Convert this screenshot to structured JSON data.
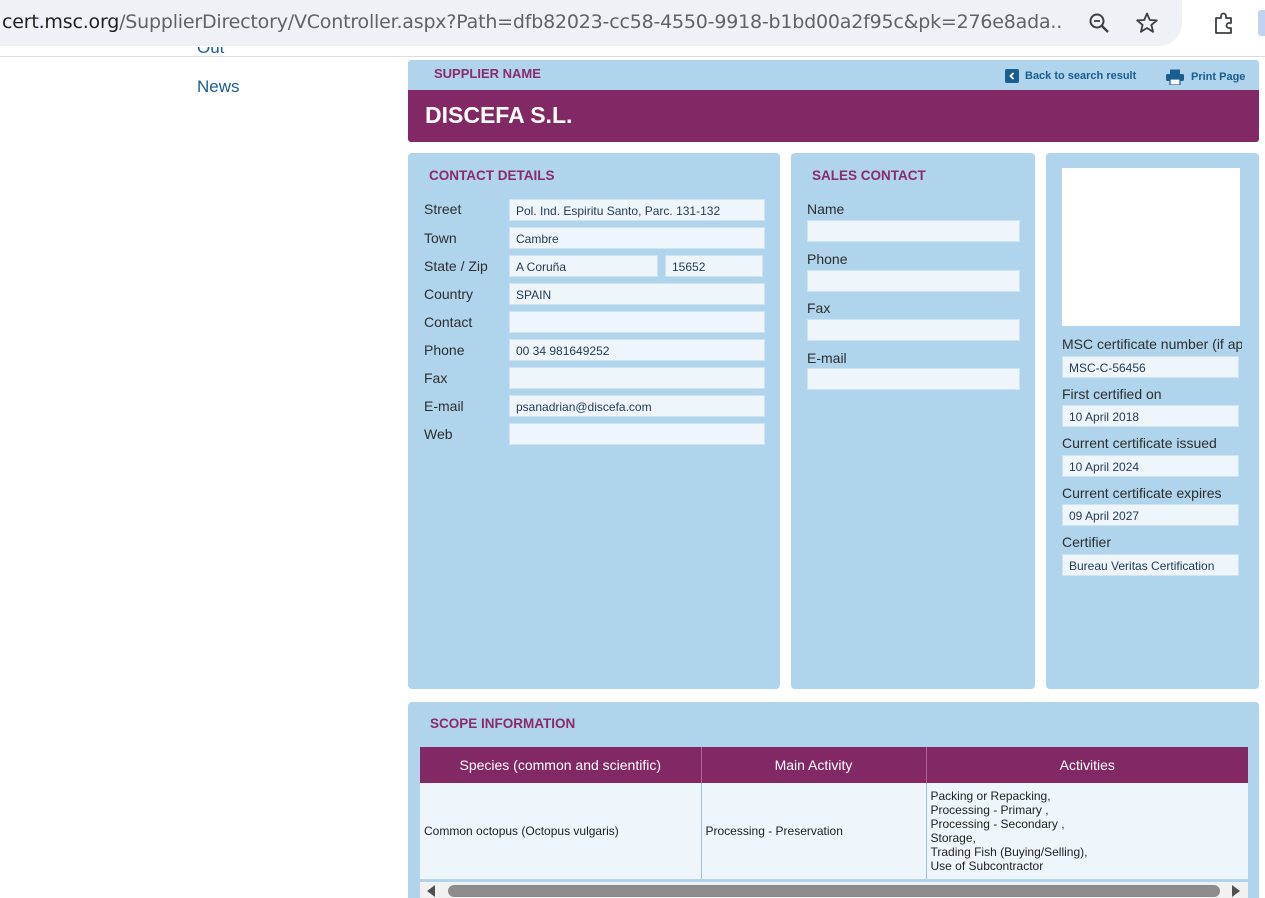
{
  "browser": {
    "url_host": "cert.msc.org",
    "url_path": "/SupplierDirectory/VController.aspx?Path=dfb82023-cc58-4550-9918-b1bd00a2f95c&pk=276e8ada..."
  },
  "nav": {
    "cut_item": "Out",
    "news": "News"
  },
  "supplier": {
    "label": "SUPPLIER NAME",
    "name": "DISCEFA S.L.",
    "back_link": "Back to search result",
    "print_link": "Print Page"
  },
  "contact": {
    "title": "CONTACT DETAILS",
    "street_label": "Street",
    "street": "Pol. Ind. Espiritu Santo, Parc. 131-132",
    "town_label": "Town",
    "town": "Cambre",
    "state_zip_label": "State / Zip",
    "state": "A Coruña",
    "zip": "15652",
    "country_label": "Country",
    "country": "SPAIN",
    "contact_label": "Contact",
    "contact": "",
    "phone_label": "Phone",
    "phone": "00 34 981649252",
    "fax_label": "Fax",
    "fax": "",
    "email_label": "E-mail",
    "email": "psanadrian@discefa.com",
    "web_label": "Web",
    "web": ""
  },
  "sales": {
    "title": "SALES CONTACT",
    "name_label": "Name",
    "name": "",
    "phone_label": "Phone",
    "phone": "",
    "fax_label": "Fax",
    "fax": "",
    "email_label": "E-mail",
    "email": ""
  },
  "certificate": {
    "number_label": "MSC certificate number (if applicable)",
    "number": "MSC-C-56456",
    "first_label": "First certified on",
    "first": "10 April 2018",
    "issued_label": "Current certificate issued",
    "issued": "10 April 2024",
    "expires_label": "Current certificate expires",
    "expires": "09 April 2027",
    "certifier_label": "Certifier",
    "certifier": "Bureau Veritas Certification"
  },
  "scope": {
    "title": "SCOPE INFORMATION",
    "headers": [
      "Species (common and scientific)",
      "Main Activity",
      "Activities"
    ],
    "rows": [
      {
        "species": "Common octopus (Octopus vulgaris)",
        "main_activity": "Processing - Preservation",
        "activities": [
          "Packing or Repacking,",
          "Processing - Primary ,",
          "Processing - Secondary ,",
          "Storage,",
          "Trading Fish (Buying/Selling),",
          "Use of Subcontractor"
        ]
      }
    ]
  },
  "colors": {
    "panel": "#afd4ec",
    "brand": "#812865",
    "title": "#8a2b6a",
    "link": "#1a5d8f"
  }
}
